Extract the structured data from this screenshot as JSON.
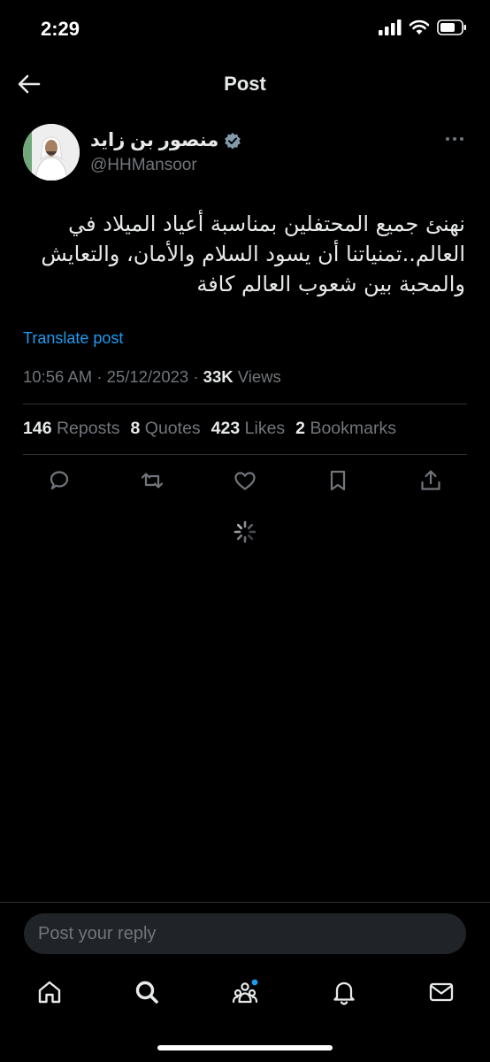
{
  "status_bar": {
    "time": "2:29"
  },
  "nav": {
    "title": "Post",
    "back_icon": "arrow-left-icon"
  },
  "author": {
    "name": "منصور بن زايد",
    "handle": "@HHMansoor",
    "verified_color": "#829aab"
  },
  "tweet": {
    "lines": [
      "نهنئ جميع المحتفلين بمناسبة أعياد الميلاد في",
      "العالم..تمنياتنا أن يسود السلام والأمان، والتعايش",
      "والمحبة بين شعوب العالم كافة"
    ]
  },
  "translate": "Translate post",
  "meta": {
    "time": "10:56 AM",
    "sep": "·",
    "date": "25/12/2023",
    "views_count": "33K",
    "views_label": "Views"
  },
  "stats": {
    "reposts_count": "146",
    "reposts_label": "Reposts",
    "quotes_count": "8",
    "quotes_label": "Quotes",
    "likes_count": "423",
    "likes_label": "Likes",
    "bookmarks_count": "2",
    "bookmarks_label": "Bookmarks"
  },
  "reply": {
    "placeholder": "Post your reply"
  },
  "colors": {
    "accent": "#1d9bf0",
    "muted": "#71767b",
    "divider": "#2f3336"
  }
}
